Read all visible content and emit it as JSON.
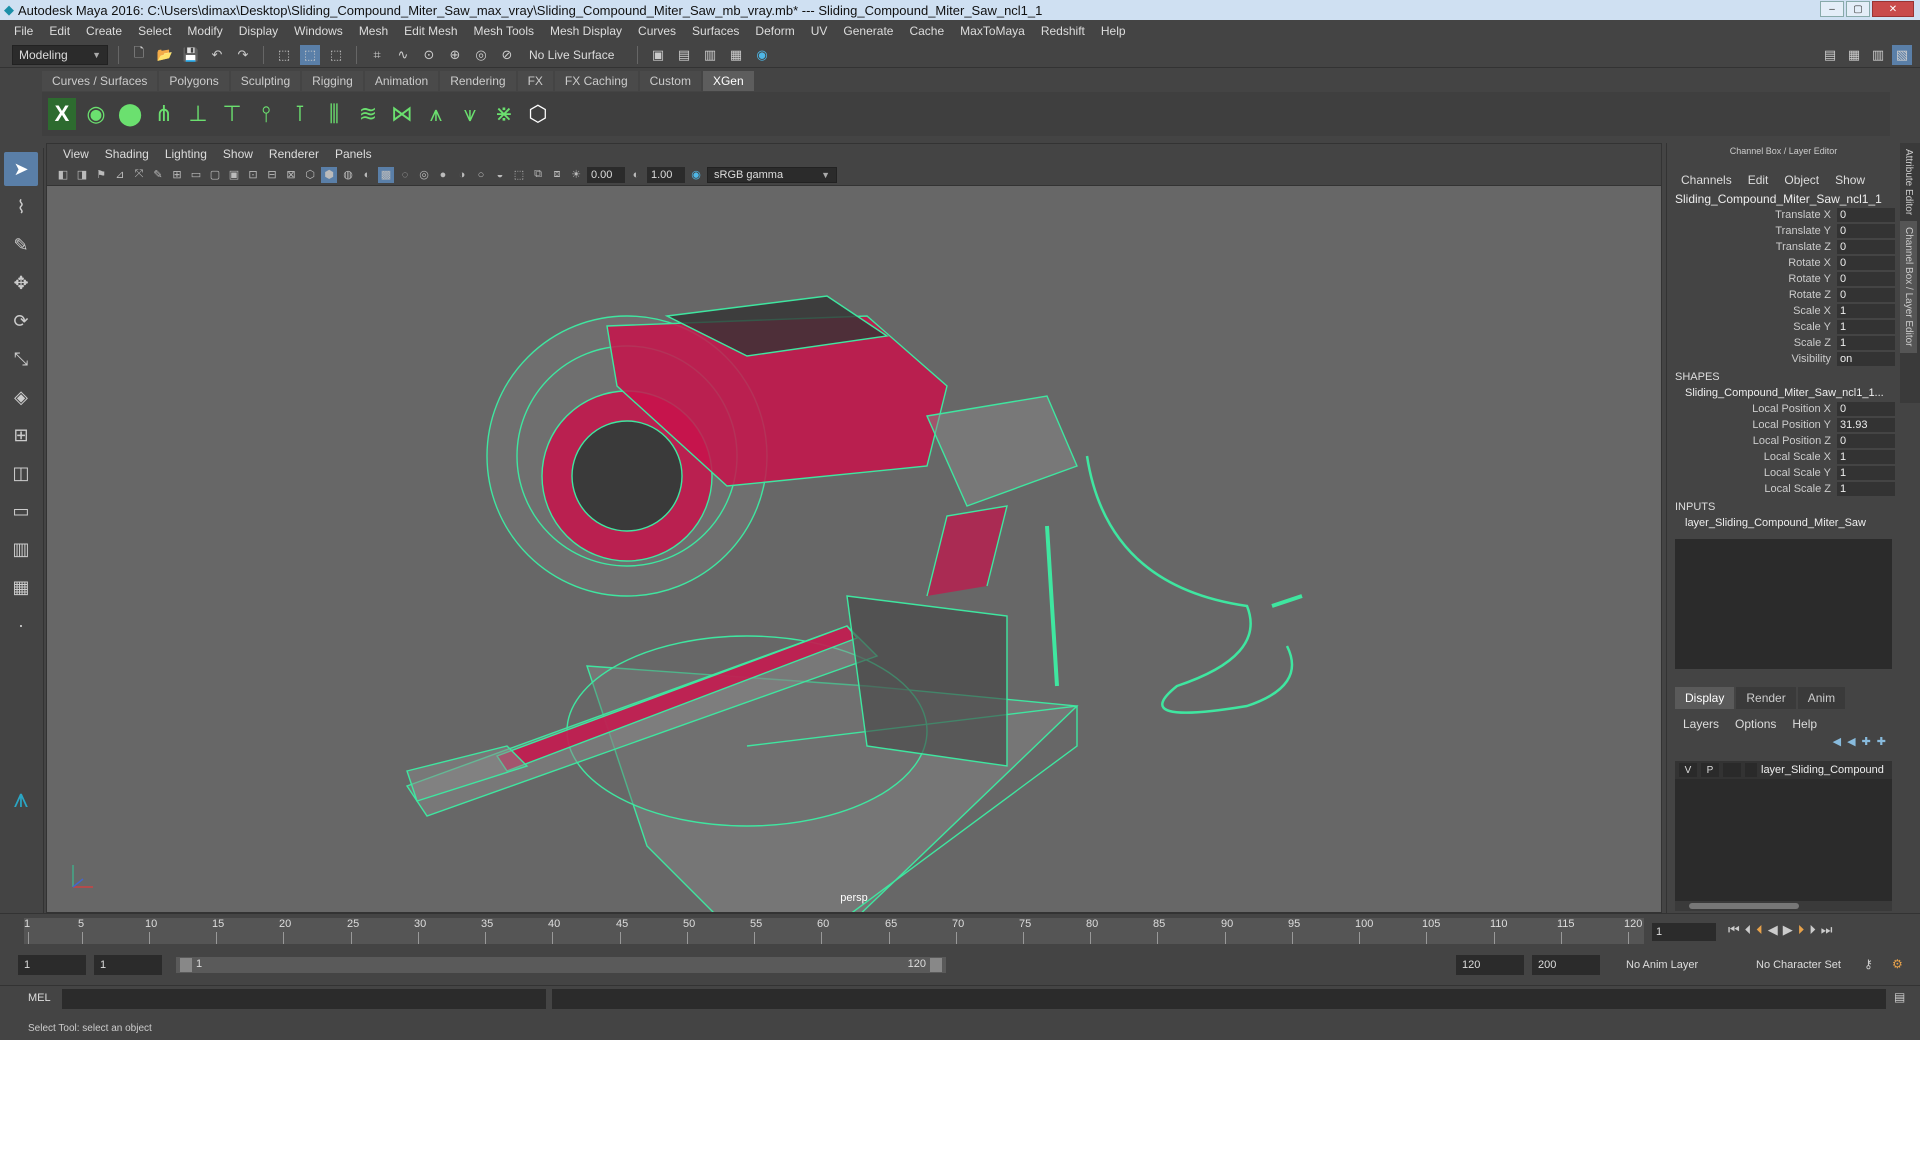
{
  "titlebar": {
    "title": "Autodesk Maya 2016: C:\\Users\\dimax\\Desktop\\Sliding_Compound_Miter_Saw_max_vray\\Sliding_Compound_Miter_Saw_mb_vray.mb*   ---   Sliding_Compound_Miter_Saw_ncl1_1"
  },
  "menubar": [
    "File",
    "Edit",
    "Create",
    "Select",
    "Modify",
    "Display",
    "Windows",
    "Mesh",
    "Edit Mesh",
    "Mesh Tools",
    "Mesh Display",
    "Curves",
    "Surfaces",
    "Deform",
    "UV",
    "Generate",
    "Cache",
    "MaxToMaya",
    "Redshift",
    "Help"
  ],
  "statusline": {
    "mode": "Modeling",
    "live_surface": "No Live Surface"
  },
  "shelf_tabs": [
    "Curves / Surfaces",
    "Polygons",
    "Sculpting",
    "Rigging",
    "Animation",
    "Rendering",
    "FX",
    "FX Caching",
    "Custom",
    "XGen"
  ],
  "viewport": {
    "menu": [
      "View",
      "Shading",
      "Lighting",
      "Show",
      "Renderer",
      "Panels"
    ],
    "exposure": "0.00",
    "gamma": "1.00",
    "colorspace": "sRGB gamma",
    "camera": "persp"
  },
  "channel_box": {
    "title": "Channel Box / Layer Editor",
    "menu": [
      "Channels",
      "Edit",
      "Object",
      "Show"
    ],
    "object": "Sliding_Compound_Miter_Saw_ncl1_1",
    "attrs": [
      {
        "l": "Translate X",
        "v": "0"
      },
      {
        "l": "Translate Y",
        "v": "0"
      },
      {
        "l": "Translate Z",
        "v": "0"
      },
      {
        "l": "Rotate X",
        "v": "0"
      },
      {
        "l": "Rotate Y",
        "v": "0"
      },
      {
        "l": "Rotate Z",
        "v": "0"
      },
      {
        "l": "Scale X",
        "v": "1"
      },
      {
        "l": "Scale Y",
        "v": "1"
      },
      {
        "l": "Scale Z",
        "v": "1"
      },
      {
        "l": "Visibility",
        "v": "on"
      }
    ],
    "shapes_label": "SHAPES",
    "shape_name": "Sliding_Compound_Miter_Saw_ncl1_1...",
    "shape_attrs": [
      {
        "l": "Local Position X",
        "v": "0"
      },
      {
        "l": "Local Position Y",
        "v": "31.93"
      },
      {
        "l": "Local Position Z",
        "v": "0"
      },
      {
        "l": "Local Scale X",
        "v": "1"
      },
      {
        "l": "Local Scale Y",
        "v": "1"
      },
      {
        "l": "Local Scale Z",
        "v": "1"
      }
    ],
    "inputs_label": "INPUTS",
    "input_name": "layer_Sliding_Compound_Miter_Saw"
  },
  "layer_editor": {
    "tabs": [
      "Display",
      "Render",
      "Anim"
    ],
    "menu": [
      "Layers",
      "Options",
      "Help"
    ],
    "layer": {
      "v": "V",
      "p": "P",
      "name": "layer_Sliding_Compound"
    }
  },
  "side_tabs": [
    "Attribute Editor",
    "Channel Box / Layer Editor"
  ],
  "timeline": {
    "ticks": [
      "1",
      "5",
      "10",
      "15",
      "20",
      "25",
      "30",
      "35",
      "40",
      "45",
      "50",
      "55",
      "60",
      "65",
      "70",
      "75",
      "80",
      "85",
      "90",
      "95",
      "100",
      "105",
      "110",
      "115",
      "120"
    ],
    "current": "1"
  },
  "range": {
    "start": "1",
    "anim_start": "1",
    "slider_start": "1",
    "slider_end": "120",
    "end": "120",
    "anim_end": "200",
    "anim_layer": "No Anim Layer",
    "char_set": "No Character Set"
  },
  "cmd": {
    "label": "MEL"
  },
  "help": "Select Tool: select an object",
  "colors": {
    "wire": "#3fe6a0",
    "accent": "#c8134b",
    "bg": "#444444"
  }
}
